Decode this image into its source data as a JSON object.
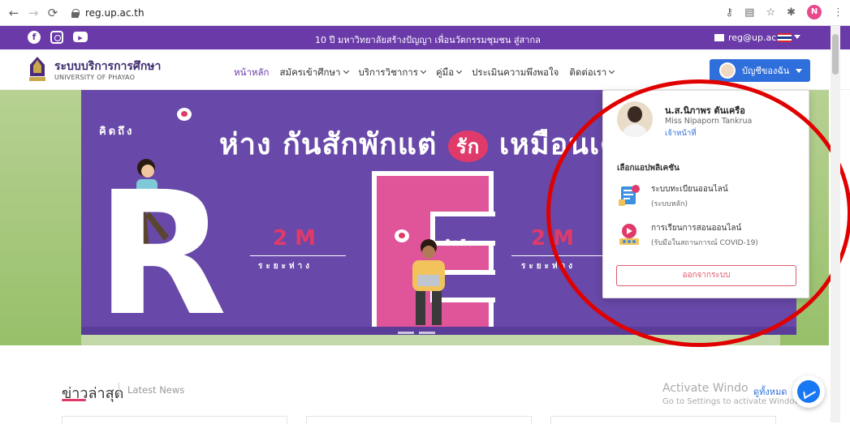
{
  "browser": {
    "back_icon": "back-arrow-icon",
    "forward_icon": "forward-arrow-icon",
    "reload_icon": "reload-icon",
    "url": "reg.up.ac.th",
    "profile_initial": "N"
  },
  "topbar": {
    "announcement": "10 ปี มหาวิทยาลัยสร้างปัญญา เพื่อนวัตกรรมชุมชน สู่สากล",
    "email": "reg@up.ac.th",
    "social": [
      "facebook-icon",
      "instagram-icon",
      "youtube-icon"
    ]
  },
  "navbar": {
    "brand_th": "ระบบบริการการศึกษา",
    "brand_en": "UNIVERSITY OF PHAYAO",
    "menu": [
      {
        "label": "หน้าหลัก",
        "dropdown": false,
        "active": true
      },
      {
        "label": "สมัครเข้าศึกษา",
        "dropdown": true,
        "active": false
      },
      {
        "label": "บริการวิชาการ",
        "dropdown": true,
        "active": false
      },
      {
        "label": "คู่มือ",
        "dropdown": true,
        "active": false
      },
      {
        "label": "ประเมินความพึงพอใจ",
        "dropdown": false,
        "active": false
      },
      {
        "label": "ติดต่อเรา",
        "dropdown": true,
        "active": false
      }
    ],
    "account_label": "บัญชีของฉัน"
  },
  "hero": {
    "think_of": "คิดถึง",
    "title_part1": "ห่าง กันสักพักแต่",
    "title_love": "รัก",
    "title_part2": "เหมือนเดิม",
    "two_m": "2 M",
    "distance": "ระยะห่าง",
    "letters": [
      "R",
      "E"
    ]
  },
  "dropdown": {
    "name": "น.ส.นิภาพร ตันเครือ",
    "english_name": "Miss Nipaporn Tankrua",
    "role": "เจ้าหน้าที่",
    "section_title": "เลือกแอปพลิเคชัน",
    "apps": [
      {
        "title": "ระบบทะเบียนออนไลน์",
        "subtitle": "(ระบบหลัก)",
        "icon": "registration-app-icon"
      },
      {
        "title": "การเรียนการสอนออนไลน์",
        "subtitle": "(รับมือในสถานการณ์ COVID-19)",
        "icon": "online-learning-app-icon"
      }
    ],
    "logout_label": "ออกจากระบบ"
  },
  "news": {
    "title": "ข่าวล่าสุด",
    "subtitle": "Latest News",
    "view_all": "ดูทั้งหมด"
  },
  "watermark": {
    "line1": "Activate Windo",
    "line2": "Go to Settings to activate Windows."
  },
  "colors": {
    "topbar": "#6a3aa8",
    "accent_blue": "#2f6fdc",
    "annotation_red": "#e00000",
    "logout_red": "#e05a6a"
  }
}
